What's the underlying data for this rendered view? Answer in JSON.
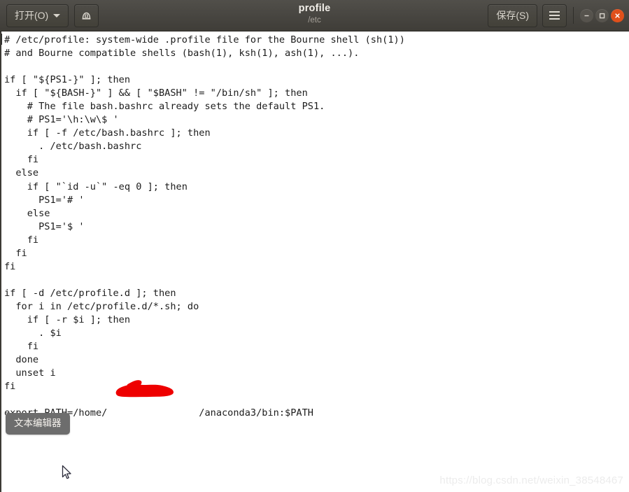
{
  "window": {
    "title": "profile",
    "subtitle": "/etc",
    "open_button": "打开(O)",
    "save_button": "保存(S)",
    "save_as_icon": "save-as-icon",
    "menu_icon": "hamburger-menu-icon",
    "minimize_icon": "minimize-icon",
    "maximize_icon": "maximize-icon",
    "close_icon": "close-icon",
    "accent_close_color": "#e0501b",
    "titlebar_color": "#474540"
  },
  "editor": {
    "content": "# /etc/profile: system-wide .profile file for the Bourne shell (sh(1))\n# and Bourne compatible shells (bash(1), ksh(1), ash(1), ...).\n\nif [ \"${PS1-}\" ]; then\n  if [ \"${BASH-}\" ] && [ \"$BASH\" != \"/bin/sh\" ]; then\n    # The file bash.bashrc already sets the default PS1.\n    # PS1='\\h:\\w\\$ '\n    if [ -f /etc/bash.bashrc ]; then\n      . /etc/bash.bashrc\n    fi\n  else\n    if [ \"`id -u`\" -eq 0 ]; then\n      PS1='# '\n    else\n      PS1='$ '\n    fi\n  fi\nfi\n\nif [ -d /etc/profile.d ]; then\n  for i in /etc/profile.d/*.sh; do\n    if [ -r $i ]; then\n      . $i\n    fi\n  done\n  unset i\nfi\n\nexport PATH=/home/                /anaconda3/bin:$PATH",
    "text_color": "#1c1c1c",
    "background_color": "#ffffff"
  },
  "annotation": {
    "redaction_color": "#ee0000",
    "redaction_name": "redacted-username"
  },
  "taskbar": {
    "label": "文本编辑器"
  },
  "watermark": {
    "text": "https://blog.csdn.net/weixin_38548467"
  }
}
